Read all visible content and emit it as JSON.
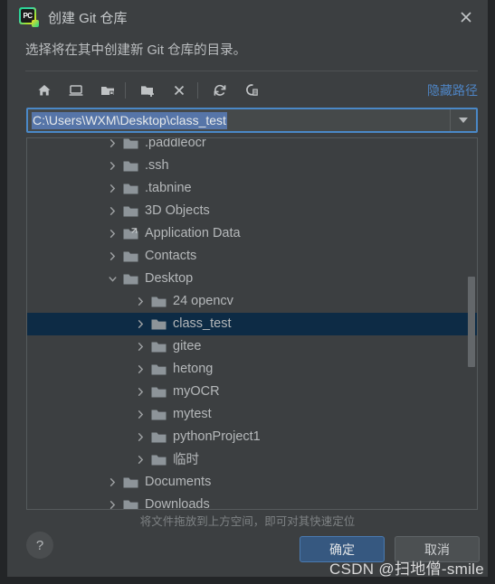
{
  "window": {
    "title": "创建 Git 仓库",
    "app_icon": "pycharm-icon",
    "icon_text": "PC",
    "close_label": "×"
  },
  "subtitle": "选择将在其中创建新 Git 仓库的目录。",
  "toolbar": {
    "buttons": [
      {
        "name": "home-icon",
        "tooltip": "主目录"
      },
      {
        "name": "desktop-icon",
        "tooltip": "桌面"
      },
      {
        "name": "project-folder-icon",
        "tooltip": "项目目录"
      },
      {
        "name": "new-folder-icon",
        "tooltip": "新建文件夹"
      },
      {
        "name": "delete-icon",
        "tooltip": "删除"
      },
      {
        "name": "refresh-icon",
        "tooltip": "刷新"
      },
      {
        "name": "show-hidden-icon",
        "tooltip": "显示隐藏文件"
      }
    ],
    "hide_path_label": "隐藏路径",
    "link_color": "#4e84c4"
  },
  "path_field": {
    "value": "C:\\Users\\WXM\\Desktop\\class_test",
    "selected": true,
    "selection_color": "#5675a8",
    "focus_border_color": "#4a88c7",
    "dropdown_icon": "chevron-down-icon"
  },
  "tree": {
    "selected_row_color": "#0d2b45",
    "rows": [
      {
        "label": ".paddleocr",
        "indent": 1,
        "expander": "collapsed",
        "icon": "folder-icon",
        "selected": false,
        "clipped": "top"
      },
      {
        "label": ".ssh",
        "indent": 1,
        "expander": "collapsed",
        "icon": "folder-icon",
        "selected": false
      },
      {
        "label": ".tabnine",
        "indent": 1,
        "expander": "collapsed",
        "icon": "folder-icon",
        "selected": false
      },
      {
        "label": "3D Objects",
        "indent": 1,
        "expander": "collapsed",
        "icon": "folder-icon",
        "selected": false
      },
      {
        "label": "Application Data",
        "indent": 1,
        "expander": "collapsed",
        "icon": "folder-shortcut-icon",
        "selected": false
      },
      {
        "label": "Contacts",
        "indent": 1,
        "expander": "collapsed",
        "icon": "folder-icon",
        "selected": false
      },
      {
        "label": "Desktop",
        "indent": 1,
        "expander": "expanded",
        "icon": "folder-icon",
        "selected": false
      },
      {
        "label": "24 opencv",
        "indent": 2,
        "expander": "collapsed",
        "icon": "folder-icon",
        "selected": false
      },
      {
        "label": "class_test",
        "indent": 2,
        "expander": "collapsed",
        "icon": "folder-icon",
        "selected": true
      },
      {
        "label": "gitee",
        "indent": 2,
        "expander": "collapsed",
        "icon": "folder-icon",
        "selected": false
      },
      {
        "label": "hetong",
        "indent": 2,
        "expander": "collapsed",
        "icon": "folder-icon",
        "selected": false
      },
      {
        "label": "myOCR",
        "indent": 2,
        "expander": "collapsed",
        "icon": "folder-icon",
        "selected": false
      },
      {
        "label": "mytest",
        "indent": 2,
        "expander": "collapsed",
        "icon": "folder-icon",
        "selected": false
      },
      {
        "label": "pythonProject1",
        "indent": 2,
        "expander": "collapsed",
        "icon": "folder-icon",
        "selected": false
      },
      {
        "label": "临时",
        "indent": 2,
        "expander": "collapsed",
        "icon": "folder-icon",
        "selected": false
      },
      {
        "label": "Documents",
        "indent": 1,
        "expander": "collapsed",
        "icon": "folder-icon",
        "selected": false
      },
      {
        "label": "Downloads",
        "indent": 1,
        "expander": "collapsed",
        "icon": "folder-icon",
        "selected": false,
        "clipped": "bottom"
      }
    ]
  },
  "drop_hint": "将文件拖放到上方空间，即可对其快速定位",
  "footer": {
    "help_label": "?",
    "ok_label": "确定",
    "cancel_label": "取消",
    "ok_color": "#365880"
  },
  "watermark": "CSDN @扫地僧-smile"
}
